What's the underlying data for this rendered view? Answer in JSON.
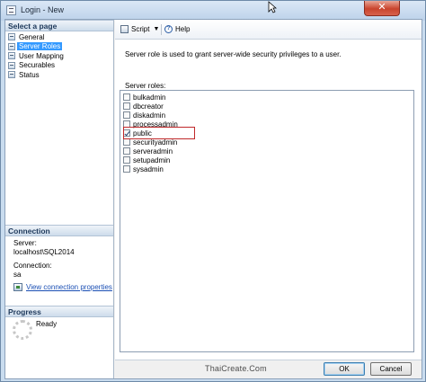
{
  "window": {
    "title": "Login - New",
    "close_glyph": "✕"
  },
  "left_pane": {
    "select_page_header": "Select a page",
    "pages": [
      {
        "label": "General",
        "selected": false
      },
      {
        "label": "Server Roles",
        "selected": true
      },
      {
        "label": "User Mapping",
        "selected": false
      },
      {
        "label": "Securables",
        "selected": false
      },
      {
        "label": "Status",
        "selected": false
      }
    ],
    "connection_header": "Connection",
    "server_label": "Server:",
    "server_value": "localhost\\SQL2014",
    "connection_label": "Connection:",
    "connection_value": "sa",
    "view_connection_link": "View connection properties",
    "progress_header": "Progress",
    "progress_status": "Ready"
  },
  "toolbar": {
    "script_label": "Script",
    "help_label": "Help"
  },
  "main": {
    "description": "Server role is used to grant server-wide security privileges to a user.",
    "roles_label": "Server roles:",
    "roles": [
      {
        "name": "bulkadmin",
        "checked": false
      },
      {
        "name": "dbcreator",
        "checked": false
      },
      {
        "name": "diskadmin",
        "checked": false
      },
      {
        "name": "processadmin",
        "checked": false
      },
      {
        "name": "public",
        "checked": true
      },
      {
        "name": "securityadmin",
        "checked": false
      },
      {
        "name": "serveradmin",
        "checked": false
      },
      {
        "name": "setupadmin",
        "checked": false
      },
      {
        "name": "sysadmin",
        "checked": false
      }
    ]
  },
  "footer": {
    "watermark": "ThaiCreate.Com",
    "ok_label": "OK",
    "cancel_label": "Cancel"
  },
  "colors": {
    "highlight": "#c0282a",
    "selection": "#3399ff",
    "link": "#1a4fb4"
  }
}
